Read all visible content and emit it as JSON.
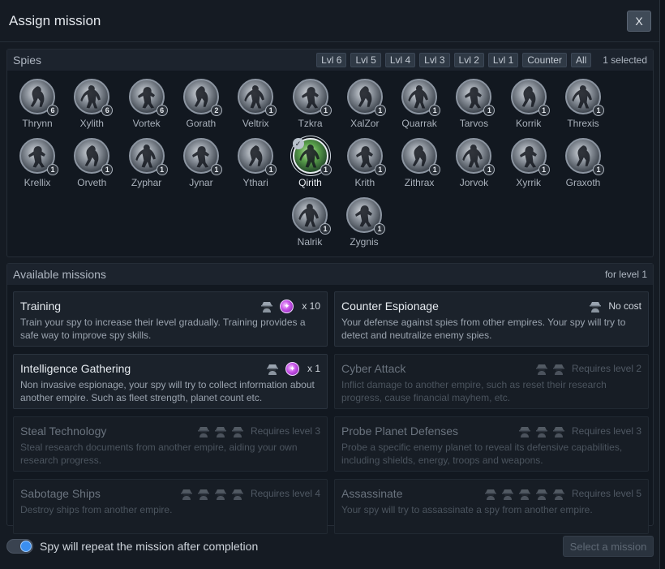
{
  "dialog": {
    "title": "Assign mission",
    "close_label": "X"
  },
  "spies_panel": {
    "title": "Spies",
    "filters": [
      "Lvl 6",
      "Lvl 5",
      "Lvl 4",
      "Lvl 3",
      "Lvl 2",
      "Lvl 1",
      "Counter",
      "All"
    ],
    "selected_count": "1 selected",
    "spies": [
      {
        "name": "Thrynn",
        "level": "6"
      },
      {
        "name": "Xylith",
        "level": "6"
      },
      {
        "name": "Vortek",
        "level": "6"
      },
      {
        "name": "Gorath",
        "level": "2"
      },
      {
        "name": "Veltrix",
        "level": "1"
      },
      {
        "name": "Tzkra",
        "level": "1"
      },
      {
        "name": "XalZor",
        "level": "1"
      },
      {
        "name": "Quarrak",
        "level": "1"
      },
      {
        "name": "Tarvos",
        "level": "1"
      },
      {
        "name": "Korrik",
        "level": "1"
      },
      {
        "name": "Threxis",
        "level": "1"
      },
      {
        "name": "Krellix",
        "level": "1"
      },
      {
        "name": "Orveth",
        "level": "1"
      },
      {
        "name": "Zyphar",
        "level": "1"
      },
      {
        "name": "Jynar",
        "level": "1"
      },
      {
        "name": "Ythari",
        "level": "1"
      },
      {
        "name": "Qirith",
        "level": "1",
        "selected": true
      },
      {
        "name": "Krith",
        "level": "1"
      },
      {
        "name": "Zithrax",
        "level": "1"
      },
      {
        "name": "Jorvok",
        "level": "1"
      },
      {
        "name": "Xyrrik",
        "level": "1"
      },
      {
        "name": "Graxoth",
        "level": "1"
      },
      {
        "name": "Nalrik",
        "level": "1"
      },
      {
        "name": "Zygnis",
        "level": "1"
      }
    ]
  },
  "missions_panel": {
    "title": "Available missions",
    "level_note": "for level 1",
    "missions": [
      {
        "title": "Training",
        "desc": "Train your spy to increase their level gradually. Training provides a safe way to improve spy skills.",
        "spy_icons": 1,
        "gem": true,
        "cost": "x 10",
        "enabled": true
      },
      {
        "title": "Counter Espionage",
        "desc": "Your defense against spies from other empires. Your spy will try to detect and neutralize enemy spies.",
        "spy_icons": 1,
        "gem": false,
        "cost": "No cost",
        "enabled": true
      },
      {
        "title": "Intelligence Gathering",
        "desc": "Non invasive espionage, your spy will try to collect information about another empire. Such as fleet strength, planet count etc.",
        "spy_icons": 1,
        "gem": true,
        "cost": "x 1",
        "enabled": true
      },
      {
        "title": "Cyber Attack",
        "desc": "Inflict damage to another empire, such as reset their research progress, cause financial mayhem, etc.",
        "spy_icons": 2,
        "gem": false,
        "cost": "Requires level 2",
        "enabled": false
      },
      {
        "title": "Steal Technology",
        "desc": "Steal research documents from another empire, aiding your own research progress.",
        "spy_icons": 3,
        "gem": false,
        "cost": "Requires level 3",
        "enabled": false
      },
      {
        "title": "Probe Planet Defenses",
        "desc": "Probe a specific enemy planet to reveal its defensive capabilities, including shields, energy, troops and weapons.",
        "spy_icons": 3,
        "gem": false,
        "cost": "Requires level 3",
        "enabled": false
      },
      {
        "title": "Sabotage Ships",
        "desc": "Destroy ships from another empire.",
        "spy_icons": 4,
        "gem": false,
        "cost": "Requires level 4",
        "enabled": false
      },
      {
        "title": "Assassinate",
        "desc": "Your spy will try to assassinate a spy from another empire.",
        "spy_icons": 5,
        "gem": false,
        "cost": "Requires level 5",
        "enabled": false
      }
    ]
  },
  "footer": {
    "repeat_label": "Spy will repeat the mission after completion",
    "repeat_enabled": true,
    "select_button": "Select a mission"
  },
  "colors": {
    "accent": "#3b8ff0",
    "gem": "#c44fe6",
    "selected_spy": "#5aa04b"
  }
}
